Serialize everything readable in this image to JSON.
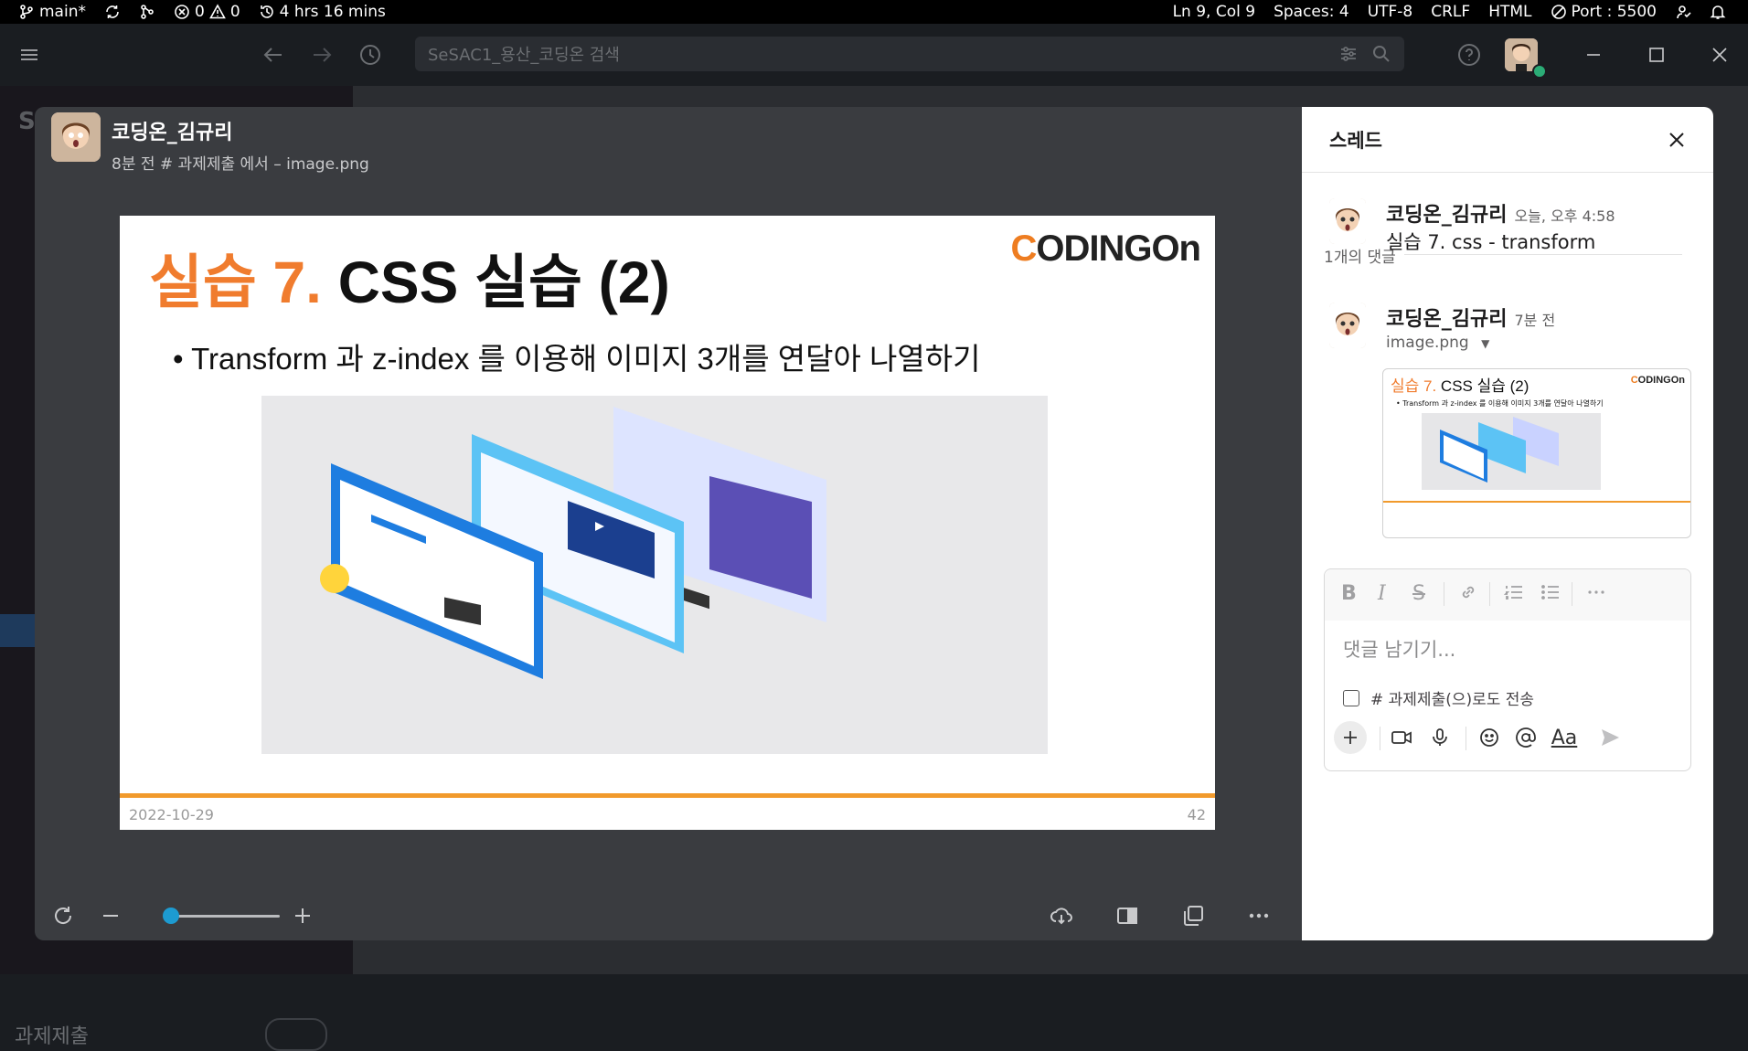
{
  "statusbar": {
    "branch": "main*",
    "errors": "0",
    "warnings": "0",
    "time_tracked": "4 hrs 16 mins",
    "cursor": "Ln 9, Col 9",
    "spaces": "Spaces: 4",
    "encoding": "UTF-8",
    "eol": "CRLF",
    "language": "HTML",
    "port": "Port : 5500"
  },
  "titlebar": {
    "search_placeholder": "SeSAC1_용산_코딩온 검색"
  },
  "background": {
    "bottom_channel": "과제제출"
  },
  "viewer": {
    "author": "코딩온_김규리",
    "meta": "8분 전 # 과제제출 에서 – image.png",
    "slide": {
      "title_num": "실습 7.",
      "title_rest": "CSS 실습 (2)",
      "logo_c": "C",
      "logo_rest": "ODINGOn",
      "bullet": "• Transform 과 z-index 를 이용해 이미지 3개를 연달아 나열하기",
      "date": "2022-10-29",
      "page": "42"
    }
  },
  "thread": {
    "title": "스레드",
    "parent": {
      "author": "코딩온_김규리",
      "time": "오늘, 오후 4:58",
      "text": "실습 7. css - transform"
    },
    "reply_count": "1개의 댓글",
    "reply": {
      "author": "코딩온_김규리",
      "time": "7분 전",
      "file": "image.png"
    },
    "thumb": {
      "title_num": "실습 7.",
      "title_rest": "CSS 실습 (2)",
      "bullet": "• Transform 과 z-index 를 이용해 이미지 3개를 연달아 나열하기"
    },
    "composer": {
      "placeholder": "댓글 남기기...",
      "also_send": "# 과제제출(으)로도 전송",
      "format_bold": "B",
      "format_italic": "I",
      "format_strike": "S",
      "aa": "Aa"
    }
  },
  "colors": {
    "accent_orange": "#f07c2e",
    "slack_blue": "#1d9bd1",
    "presence_green": "#2bac76"
  }
}
